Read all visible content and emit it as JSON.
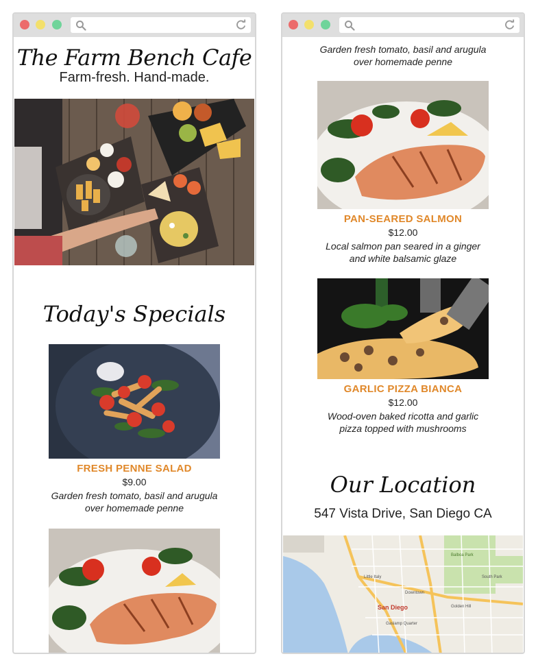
{
  "cafe": {
    "title": "The Farm Bench Cafe",
    "tagline": "Farm-fresh. Hand-made."
  },
  "specials": {
    "title": "Today's Specials",
    "items": [
      {
        "name": "FRESH PENNE SALAD",
        "price": "$9.00",
        "description": "Garden fresh tomato, basil and arugula over homemade penne"
      },
      {
        "name": "PAN-SEARED SALMON",
        "price": "$12.00",
        "description": "Local salmon pan seared in a ginger and white balsamic glaze"
      },
      {
        "name": "GARLIC PIZZA BIANCA",
        "price": "$12.00",
        "description": "Wood-oven baked ricotta and garlic pizza topped with mushrooms"
      }
    ]
  },
  "location": {
    "title": "Our Location",
    "address": "547 Vista Drive, San Diego CA"
  },
  "map": {
    "labels": [
      "San Diego",
      "Little Italy",
      "Gaslamp Quarter",
      "South Park",
      "Golden Hill",
      "Balboa Park",
      "Downtown"
    ]
  },
  "colors": {
    "accent": "#e0882a",
    "frame": "#d6d6d6",
    "chrome": "#dedede"
  },
  "icons": [
    "search-icon",
    "reload-icon"
  ]
}
